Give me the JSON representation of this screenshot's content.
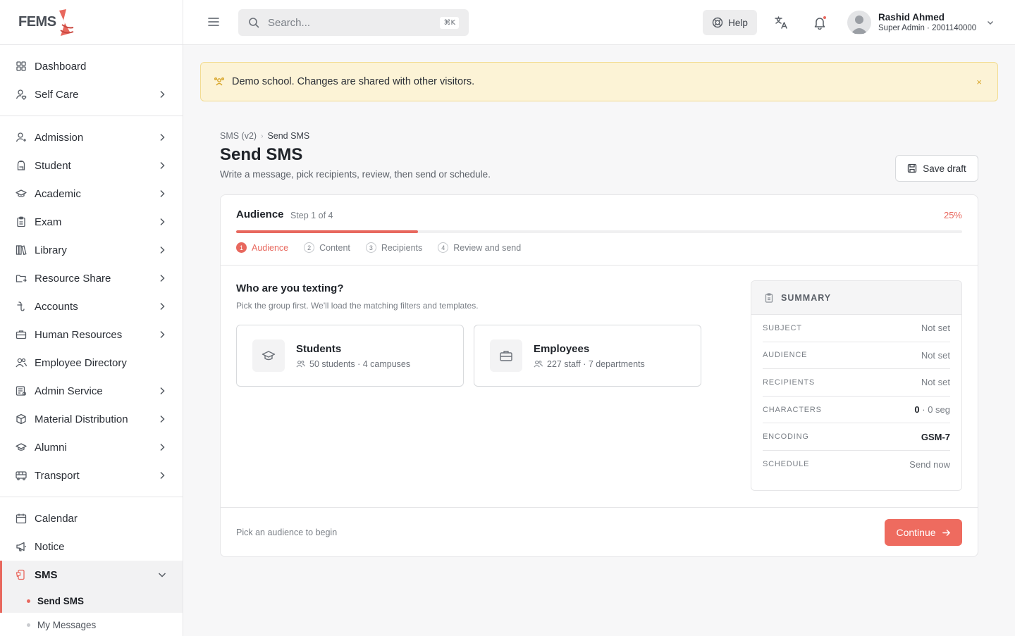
{
  "brand": {
    "logo_text": "FEMS",
    "accent": "#e8685e"
  },
  "sidebar": {
    "group1": [
      {
        "label": "Dashboard",
        "icon": "grid-icon",
        "chevron": false
      },
      {
        "label": "Self Care",
        "icon": "user-heart-icon",
        "chevron": true
      }
    ],
    "group2": [
      {
        "label": "Admission",
        "icon": "user-plus-icon",
        "chevron": true
      },
      {
        "label": "Student",
        "icon": "backpack-icon",
        "chevron": true
      },
      {
        "label": "Academic",
        "icon": "graduation-cap-icon",
        "chevron": true
      },
      {
        "label": "Exam",
        "icon": "clipboard-icon",
        "chevron": true
      },
      {
        "label": "Library",
        "icon": "books-icon",
        "chevron": true
      },
      {
        "label": "Resource Share",
        "icon": "folder-share-icon",
        "chevron": true
      },
      {
        "label": "Accounts",
        "icon": "currency-icon",
        "chevron": true
      },
      {
        "label": "Human Resources",
        "icon": "briefcase-icon",
        "chevron": true
      },
      {
        "label": "Employee Directory",
        "icon": "users-icon",
        "chevron": false
      },
      {
        "label": "Admin Service",
        "icon": "id-card-icon",
        "chevron": true
      },
      {
        "label": "Material Distribution",
        "icon": "box-icon",
        "chevron": true
      },
      {
        "label": "Alumni",
        "icon": "graduation-cap-icon",
        "chevron": true
      },
      {
        "label": "Transport",
        "icon": "bus-icon",
        "chevron": true
      }
    ],
    "group3": [
      {
        "label": "Calendar",
        "icon": "calendar-icon",
        "chevron": false
      },
      {
        "label": "Notice",
        "icon": "megaphone-icon",
        "chevron": false
      },
      {
        "label": "SMS",
        "icon": "sms-icon",
        "chevron": true,
        "active": true
      }
    ],
    "sms_sub": [
      {
        "label": "Send SMS",
        "active": true
      },
      {
        "label": "My Messages",
        "active": false
      }
    ]
  },
  "topbar": {
    "search_placeholder": "Search...",
    "search_shortcut": "⌘K",
    "help_label": "Help",
    "user_name": "Rashid Ahmed",
    "user_role": "Super Admin · 2001140000"
  },
  "banner": {
    "text": "Demo school. Changes are shared with other visitors.",
    "close": "×"
  },
  "page": {
    "breadcrumb_parent": "SMS (v2)",
    "breadcrumb_sep": "›",
    "breadcrumb_current": "Send SMS",
    "title": "Send SMS",
    "subtitle": "Write a message, pick recipients, review, then send or schedule.",
    "save_draft": "Save draft"
  },
  "wizard": {
    "step_title": "Audience",
    "step_count": "Step 1 of 4",
    "percent_label": "25%",
    "progress": 0.25,
    "steps": [
      {
        "num": "1",
        "label": "Audience",
        "active": true
      },
      {
        "num": "2",
        "label": "Content",
        "active": false
      },
      {
        "num": "3",
        "label": "Recipients",
        "active": false
      },
      {
        "num": "4",
        "label": "Review and send",
        "active": false
      }
    ],
    "question": "Who are you texting?",
    "question_sub": "Pick the group first. We'll load the matching filters and templates.",
    "audiences": [
      {
        "title": "Students",
        "meta": "50 students · 4 campuses",
        "icon": "graduation-cap-icon"
      },
      {
        "title": "Employees",
        "meta": "227 staff · 7 departments",
        "icon": "briefcase-icon"
      }
    ],
    "footer_hint": "Pick an audience to begin",
    "continue_label": "Continue"
  },
  "summary": {
    "title": "SUMMARY",
    "rows": [
      {
        "key": "SUBJECT",
        "value": "Not set"
      },
      {
        "key": "AUDIENCE",
        "value": "Not set"
      },
      {
        "key": "RECIPIENTS",
        "value": "Not set"
      },
      {
        "key": "CHARACTERS",
        "value_strong": "0",
        "value_muted": " · 0 seg"
      },
      {
        "key": "ENCODING",
        "value_strong": "GSM-7"
      },
      {
        "key": "SCHEDULE",
        "value": "Send now"
      }
    ]
  }
}
